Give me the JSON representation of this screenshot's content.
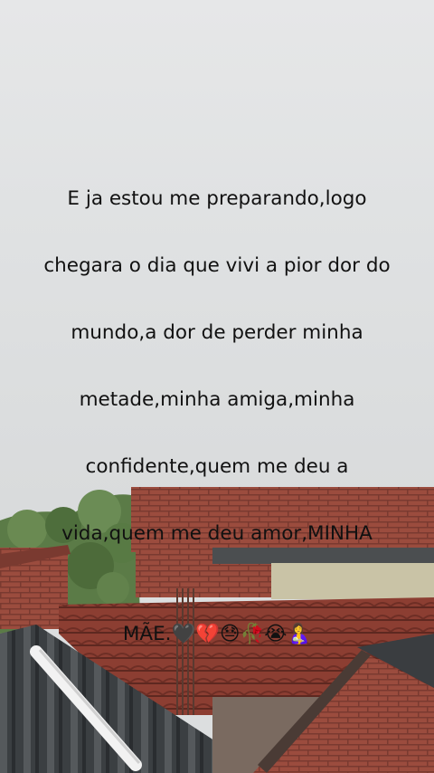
{
  "caption": {
    "lines": [
      "E ja estou me preparando,logo",
      "chegara o dia que vivi a pior dor do",
      "mundo,a dor de perder minha",
      "metade,minha amiga,minha",
      "confidente,quem me deu a",
      "vida,quem me deu amor,MINHA"
    ],
    "last_line": "MÃE.",
    "emojis": [
      "🖤",
      "💔",
      "😓",
      "🥀",
      "😭",
      "🤱"
    ]
  },
  "scene": {
    "sky_color": "#e2e4e5",
    "brick_color": "#9a4a3c",
    "roof_tile_color": "#8a3b30",
    "asbestos_roof_color": "#3c3f41",
    "foliage_color": "#5a7a45"
  }
}
